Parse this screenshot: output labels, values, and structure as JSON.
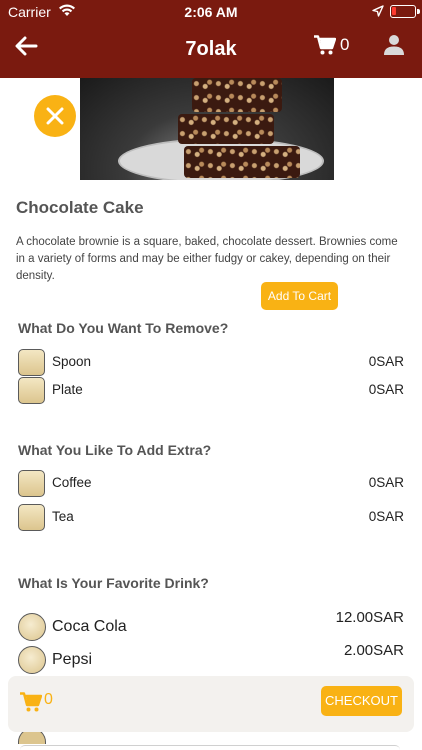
{
  "status_bar": {
    "carrier": "Carrier",
    "time": "2:06 AM"
  },
  "header": {
    "title": "7olak",
    "cart_count": "0"
  },
  "product": {
    "name": "Chocolate Cake",
    "description": "A chocolate brownie is a square, baked, chocolate dessert. Brownies come in a variety of forms and may be either fudgy or cakey, depending on their density.",
    "add_to_cart_label": "Add To Cart"
  },
  "remove_section": {
    "title": "What Do You Want To Remove?",
    "items": [
      {
        "label": "Spoon",
        "price": "0SAR"
      },
      {
        "label": "Plate",
        "price": "0SAR"
      }
    ]
  },
  "extra_section": {
    "title": "What You Like To Add Extra?",
    "items": [
      {
        "label": "Coffee",
        "price": "0SAR"
      },
      {
        "label": "Tea",
        "price": "0SAR"
      }
    ]
  },
  "drink_section": {
    "title": "What Is Your Favorite Drink?",
    "items": [
      {
        "label": "Coca Cola",
        "price": "12.00SAR"
      },
      {
        "label": "Pepsi",
        "price": "2.00SAR"
      }
    ]
  },
  "bottom_bar": {
    "cart_count": "0",
    "checkout_label": "CHECKOUT"
  },
  "icons": [
    "wifi-icon",
    "location-arrow-icon",
    "battery-icon",
    "back-arrow-icon",
    "cart-icon",
    "user-icon",
    "close-icon"
  ],
  "colors": {
    "header_bg": "#7a1a0f",
    "accent": "#f9b214",
    "bottom_bar_bg": "#f3f1ee"
  }
}
